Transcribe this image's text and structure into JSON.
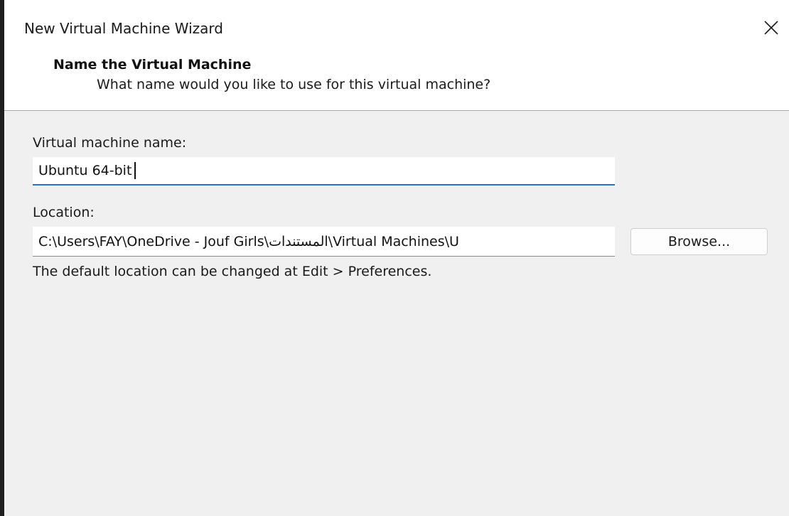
{
  "window": {
    "title": "New Virtual Machine Wizard"
  },
  "header": {
    "title": "Name the Virtual Machine",
    "subtitle": "What name would you like to use for this virtual machine?"
  },
  "form": {
    "vm_name_label": "Virtual machine name:",
    "vm_name_value": "Ubuntu 64-bit",
    "location_label": "Location:",
    "location_value": "C:\\Users\\FAY\\OneDrive - Jouf Girls\\المستندات\\Virtual Machines\\U",
    "browse_label": "Browse...",
    "hint": "The default location can be changed at Edit > Preferences."
  },
  "icons": {
    "close": "close-icon"
  },
  "colors": {
    "focus_accent": "#2a6fc9",
    "content_background": "#f0f0f0",
    "header_background": "#ffffff"
  }
}
